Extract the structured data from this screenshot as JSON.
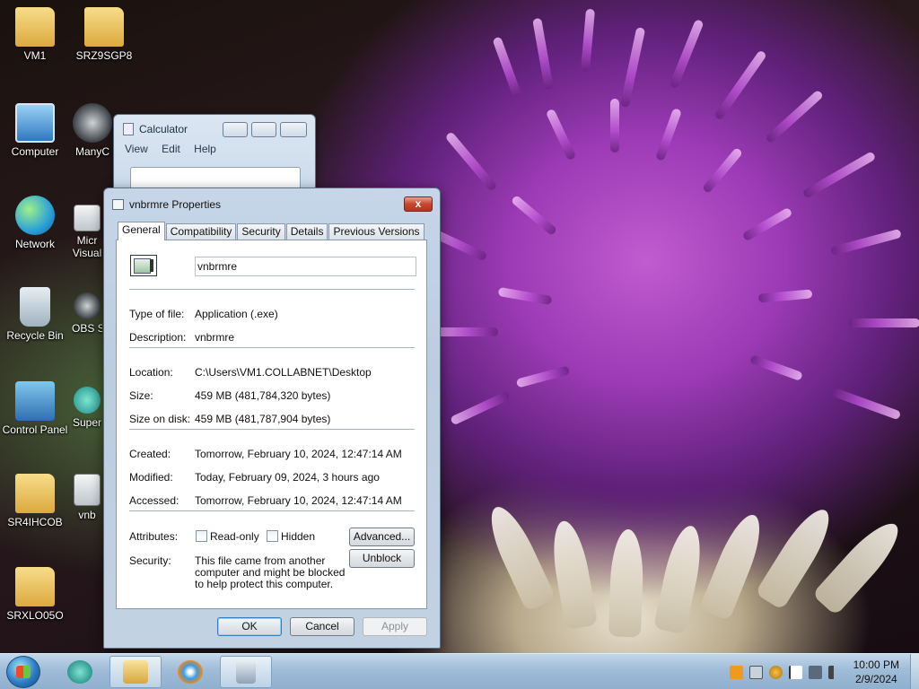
{
  "desktop": {
    "icons": [
      {
        "label": "VM1",
        "kind": "folder-user-icon"
      },
      {
        "label": "SRZ9SGP8",
        "kind": "folder-icon"
      },
      {
        "label": "Computer",
        "kind": "computer-icon"
      },
      {
        "label": "ManyC",
        "kind": "manycam-icon"
      },
      {
        "label": "Network",
        "kind": "network-icon"
      },
      {
        "label": "Micr",
        "kind": "app-shortcut-icon"
      },
      {
        "label": "Visual",
        "kind": "app-shortcut-icon"
      },
      {
        "label": "Recycle Bin",
        "kind": "recycle-bin-icon"
      },
      {
        "label": "OBS S",
        "kind": "obs-icon"
      },
      {
        "label": "Control Panel",
        "kind": "control-panel-icon"
      },
      {
        "label": "Super",
        "kind": "app-shortcut-icon"
      },
      {
        "label": "SR4IHCOB",
        "kind": "folder-icon"
      },
      {
        "label": "vnb",
        "kind": "exe-file-icon"
      },
      {
        "label": "SRXLO05O",
        "kind": "folder-icon"
      }
    ]
  },
  "calculator": {
    "title": "Calculator",
    "menu": [
      "View",
      "Edit",
      "Help"
    ]
  },
  "dialog": {
    "title": "vnbrmre Properties",
    "close_label": "x",
    "tabs": [
      "General",
      "Compatibility",
      "Security",
      "Details",
      "Previous Versions"
    ],
    "file_name": "vnbrmre",
    "fields": {
      "type_label": "Type of file:",
      "type_value": "Application (.exe)",
      "description_label": "Description:",
      "description_value": "vnbrmre",
      "location_label": "Location:",
      "location_value": "C:\\Users\\VM1.COLLABNET\\Desktop",
      "size_label": "Size:",
      "size_value": "459 MB (481,784,320 bytes)",
      "size_on_disk_label": "Size on disk:",
      "size_on_disk_value": "459 MB (481,787,904 bytes)",
      "created_label": "Created:",
      "created_value": "Tomorrow, February 10, 2024, 12:47:14 AM",
      "modified_label": "Modified:",
      "modified_value": "Today, February 09, 2024, 3 hours ago",
      "accessed_label": "Accessed:",
      "accessed_value": "Tomorrow, February 10, 2024, 12:47:14 AM",
      "attributes_label": "Attributes:",
      "readonly_label": "Read-only",
      "hidden_label": "Hidden",
      "advanced_label": "Advanced...",
      "security_label": "Security:",
      "security_text": "This file came from another computer and might be blocked to help protect this computer.",
      "unblock_label": "Unblock"
    },
    "buttons": {
      "ok": "OK",
      "cancel": "Cancel",
      "apply": "Apply"
    }
  },
  "taskbar": {
    "time": "10:00 PM",
    "date": "2/9/2024",
    "pinned": [
      "start-orb-icon",
      "teal-app-icon",
      "explorer-icon",
      "windows-media-icon",
      "calculator-icon"
    ],
    "tray": [
      "app-orange-icon",
      "network-tray-icon",
      "search-tray-icon",
      "flag-icon",
      "network-status-icon",
      "volume-icon"
    ]
  }
}
